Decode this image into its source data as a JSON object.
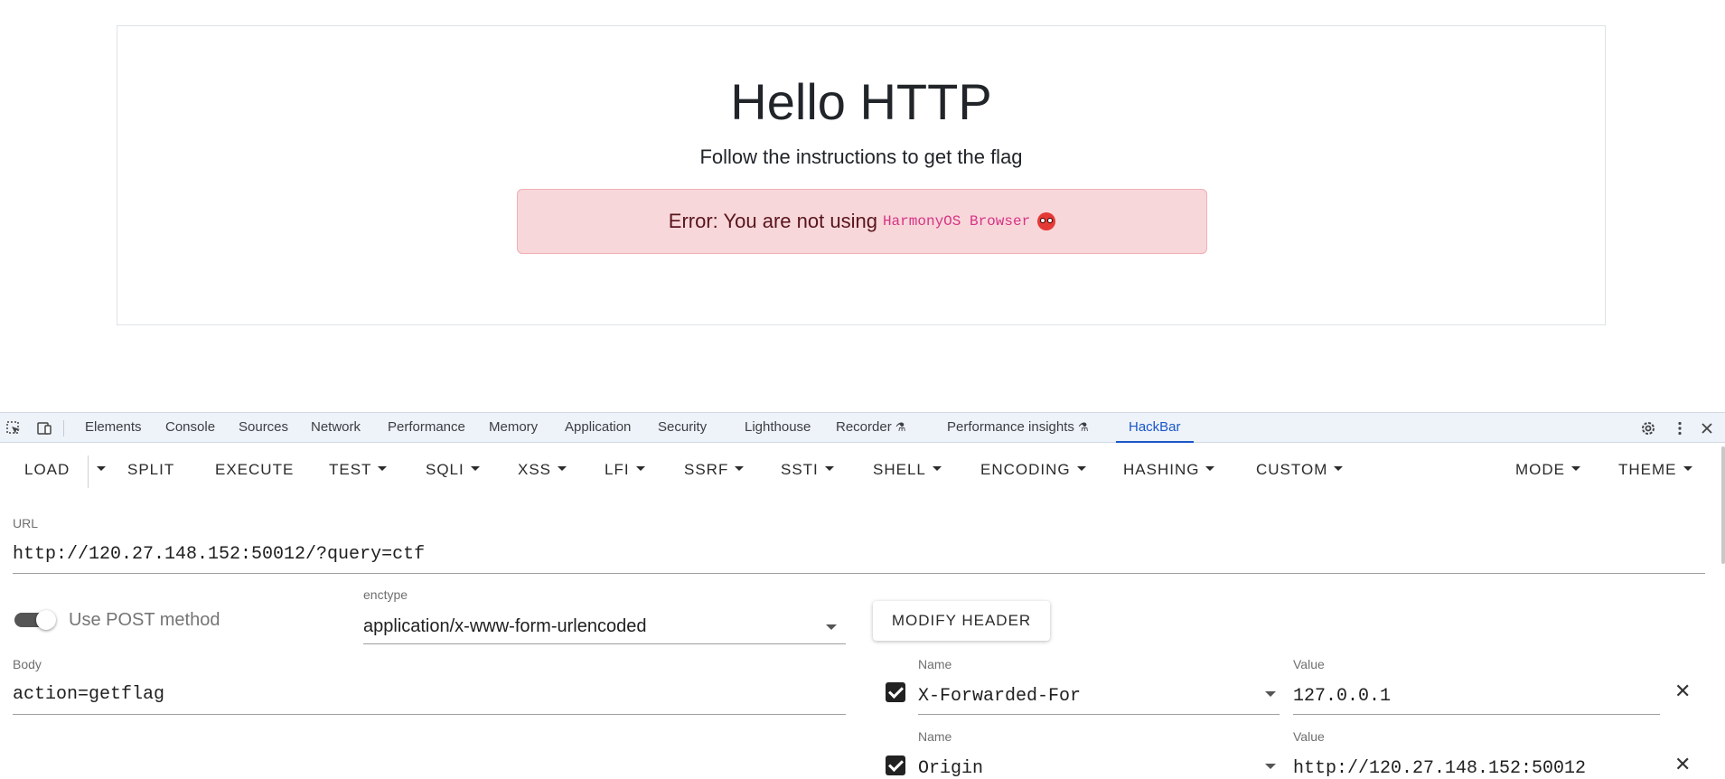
{
  "page": {
    "title": "Hello HTTP",
    "subtitle": "Follow the instructions to get the flag",
    "alert_prefix": "Error: You are not using",
    "alert_code": "HarmonyOS Browser"
  },
  "devtools": {
    "tabs": [
      "Elements",
      "Console",
      "Sources",
      "Network",
      "Performance",
      "Memory",
      "Application",
      "Security",
      "Lighthouse",
      "Recorder",
      "Performance insights",
      "HackBar"
    ],
    "active_tab": "HackBar"
  },
  "hackbar": {
    "toolbar": [
      "LOAD",
      "SPLIT",
      "EXECUTE",
      "TEST",
      "SQLI",
      "XSS",
      "LFI",
      "SSRF",
      "SSTI",
      "SHELL",
      "ENCODING",
      "HASHING",
      "CUSTOM",
      "MODE",
      "THEME"
    ],
    "url_label": "URL",
    "url_value": "http://120.27.148.152:50012/?query=ctf",
    "post_toggle_label": "Use POST method",
    "post_enabled": true,
    "enctype_label": "enctype",
    "enctype_value": "application/x-www-form-urlencoded",
    "modify_header_label": "MODIFY HEADER",
    "body_label": "Body",
    "body_value": "action=getflag",
    "headers": [
      {
        "name_label": "Name",
        "name": "X-Forwarded-For",
        "value_label": "Value",
        "value": "127.0.0.1",
        "checked": true
      },
      {
        "name_label": "Name",
        "name": "Origin",
        "value_label": "Value",
        "value": "http://120.27.148.152:50012",
        "checked": true
      }
    ]
  }
}
